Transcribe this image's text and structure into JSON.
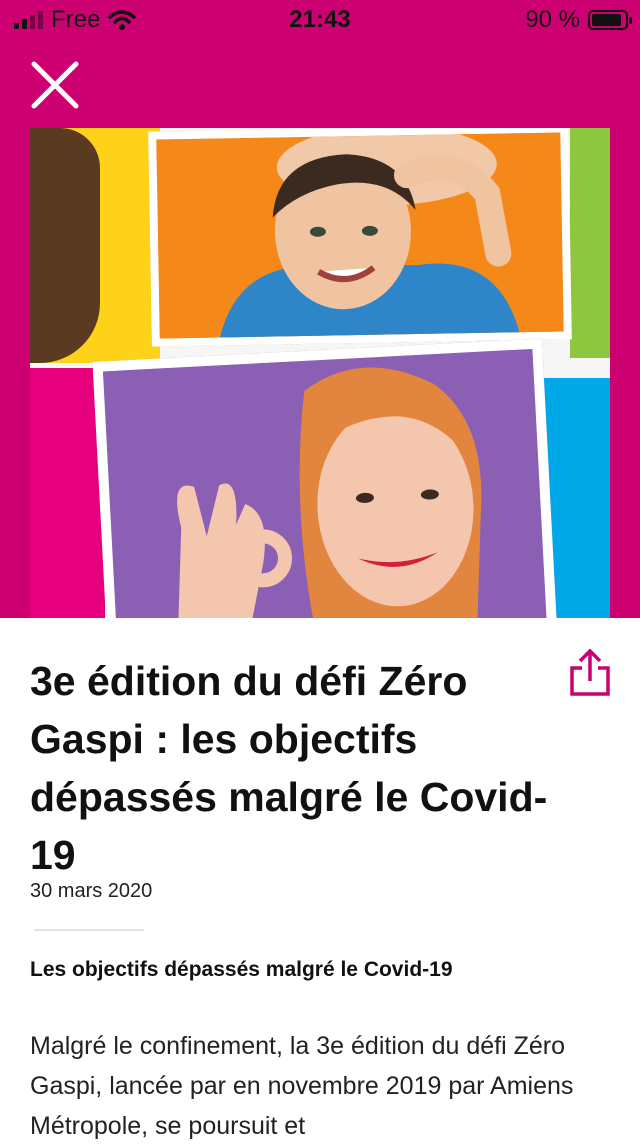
{
  "status_bar": {
    "carrier": "Free",
    "time": "21:43",
    "battery": "90 %",
    "battery_level": 0.9
  },
  "header": {
    "close_icon": "close-icon",
    "background_color": "#cc0070"
  },
  "article": {
    "title": "3e édition du défi Zéro Gaspi : les objectifs dépassés malgré le Covid-19",
    "date": "30 mars 2020",
    "subtitle": "Les objectifs dépassés malgré le Covid-19",
    "body": "Malgré le confinement, la 3e édition du défi Zéro Gaspi, lancée par en novembre 2019 par Amiens Métropole, se poursuit et",
    "share_icon": "share-icon",
    "accent_color": "#cc0070"
  }
}
